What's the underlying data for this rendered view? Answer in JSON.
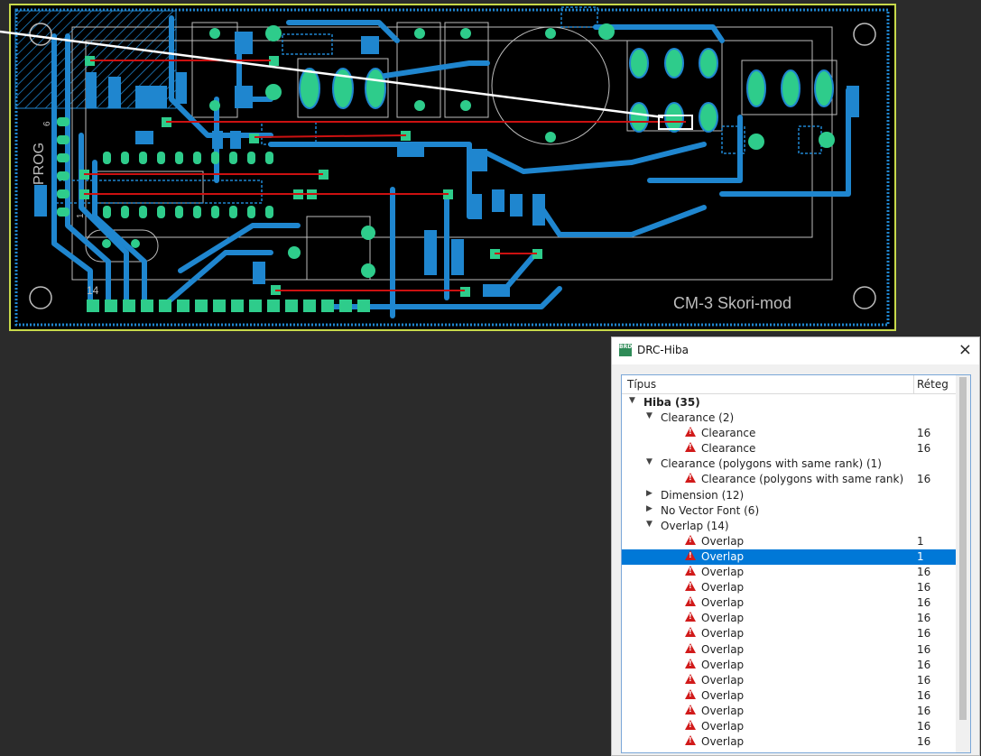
{
  "board": {
    "texts": {
      "prog": "PROG",
      "num6": "6",
      "num1": "1",
      "num14": "14",
      "title": "CM-3 Skori-mod"
    },
    "colors": {
      "background": "#000000",
      "copper_top": "#1f86cf",
      "pads": "#2ecc8b",
      "airwire": "#cc1111",
      "silk": "#bdbdbd",
      "outline": "#c8d94a"
    }
  },
  "drc": {
    "title": "DRC-Hiba",
    "app_icon": "BRD",
    "close_icon": "×",
    "col_type": "Típus",
    "col_layer": "Réteg",
    "selected_index": 10,
    "rows": [
      {
        "level": 0,
        "expander": "open",
        "label": "Hiba (35)",
        "layer": "",
        "bold": true
      },
      {
        "level": 1,
        "expander": "open",
        "label": "Clearance (2)",
        "layer": ""
      },
      {
        "level": 2,
        "expander": "",
        "icon": "warning-icon",
        "label": "Clearance",
        "layer": "16"
      },
      {
        "level": 2,
        "expander": "",
        "icon": "warning-icon",
        "label": "Clearance",
        "layer": "16"
      },
      {
        "level": 1,
        "expander": "open",
        "label": "Clearance (polygons with same rank) (1)",
        "layer": ""
      },
      {
        "level": 2,
        "expander": "",
        "icon": "warning-icon",
        "label": "Clearance (polygons with same rank)",
        "layer": "16"
      },
      {
        "level": 1,
        "expander": "closed",
        "label": "Dimension (12)",
        "layer": ""
      },
      {
        "level": 1,
        "expander": "closed",
        "label": "No Vector Font (6)",
        "layer": ""
      },
      {
        "level": 1,
        "expander": "open",
        "label": "Overlap (14)",
        "layer": ""
      },
      {
        "level": 2,
        "expander": "",
        "icon": "warning-icon",
        "label": "Overlap",
        "layer": "1"
      },
      {
        "level": 2,
        "expander": "",
        "icon": "warning-icon",
        "label": "Overlap",
        "layer": "1"
      },
      {
        "level": 2,
        "expander": "",
        "icon": "warning-icon",
        "label": "Overlap",
        "layer": "16"
      },
      {
        "level": 2,
        "expander": "",
        "icon": "warning-icon",
        "label": "Overlap",
        "layer": "16"
      },
      {
        "level": 2,
        "expander": "",
        "icon": "warning-icon",
        "label": "Overlap",
        "layer": "16"
      },
      {
        "level": 2,
        "expander": "",
        "icon": "warning-icon",
        "label": "Overlap",
        "layer": "16"
      },
      {
        "level": 2,
        "expander": "",
        "icon": "warning-icon",
        "label": "Overlap",
        "layer": "16"
      },
      {
        "level": 2,
        "expander": "",
        "icon": "warning-icon",
        "label": "Overlap",
        "layer": "16"
      },
      {
        "level": 2,
        "expander": "",
        "icon": "warning-icon",
        "label": "Overlap",
        "layer": "16"
      },
      {
        "level": 2,
        "expander": "",
        "icon": "warning-icon",
        "label": "Overlap",
        "layer": "16"
      },
      {
        "level": 2,
        "expander": "",
        "icon": "warning-icon",
        "label": "Overlap",
        "layer": "16"
      },
      {
        "level": 2,
        "expander": "",
        "icon": "warning-icon",
        "label": "Overlap",
        "layer": "16"
      },
      {
        "level": 2,
        "expander": "",
        "icon": "warning-icon",
        "label": "Overlap",
        "layer": "16"
      },
      {
        "level": 2,
        "expander": "",
        "icon": "warning-icon",
        "label": "Overlap",
        "layer": "16"
      }
    ]
  }
}
